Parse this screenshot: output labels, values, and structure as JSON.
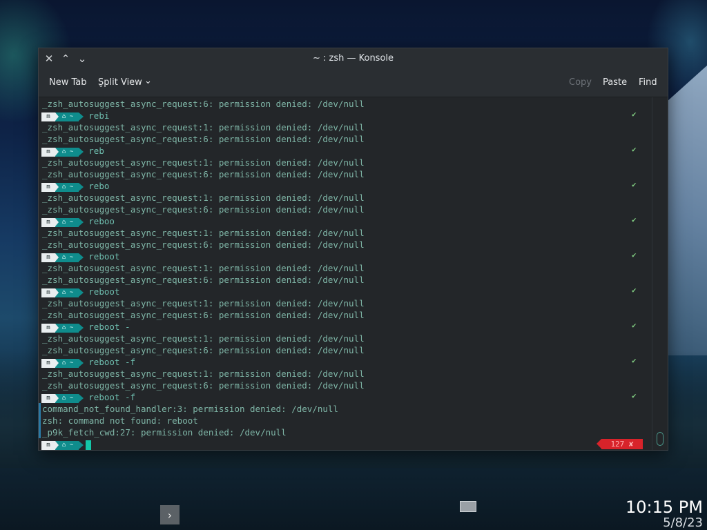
{
  "window": {
    "title": "~ : zsh — Konsole",
    "close_glyph": "✕",
    "minimize_glyph": "⌃",
    "maximize_glyph": "⌄"
  },
  "toolbar": {
    "new_tab": "New Tab",
    "split_view": "Split View",
    "split_chevron": "⌄",
    "copy": "Copy",
    "paste": "Paste",
    "find": "Find"
  },
  "prompt": {
    "os_glyph": "m",
    "home_glyph": "⌂ ~",
    "check": "✔"
  },
  "terminal_lines": [
    {
      "type": "text",
      "text": "_zsh_autosuggest_async_request:6: permission denied: /dev/null"
    },
    {
      "type": "prompt",
      "cmd": "rebi"
    },
    {
      "type": "text",
      "text": "_zsh_autosuggest_async_request:1: permission denied: /dev/null"
    },
    {
      "type": "text",
      "text": "_zsh_autosuggest_async_request:6: permission denied: /dev/null"
    },
    {
      "type": "prompt",
      "cmd": "reb"
    },
    {
      "type": "text",
      "text": "_zsh_autosuggest_async_request:1: permission denied: /dev/null"
    },
    {
      "type": "text",
      "text": "_zsh_autosuggest_async_request:6: permission denied: /dev/null"
    },
    {
      "type": "prompt",
      "cmd": "rebo"
    },
    {
      "type": "text",
      "text": "_zsh_autosuggest_async_request:1: permission denied: /dev/null"
    },
    {
      "type": "text",
      "text": "_zsh_autosuggest_async_request:6: permission denied: /dev/null"
    },
    {
      "type": "prompt",
      "cmd": "reboo"
    },
    {
      "type": "text",
      "text": "_zsh_autosuggest_async_request:1: permission denied: /dev/null"
    },
    {
      "type": "text",
      "text": "_zsh_autosuggest_async_request:6: permission denied: /dev/null"
    },
    {
      "type": "prompt",
      "cmd": "reboot"
    },
    {
      "type": "text",
      "text": "_zsh_autosuggest_async_request:1: permission denied: /dev/null"
    },
    {
      "type": "text",
      "text": "_zsh_autosuggest_async_request:6: permission denied: /dev/null"
    },
    {
      "type": "prompt",
      "cmd": "reboot"
    },
    {
      "type": "text",
      "text": "_zsh_autosuggest_async_request:1: permission denied: /dev/null"
    },
    {
      "type": "text",
      "text": "_zsh_autosuggest_async_request:6: permission denied: /dev/null"
    },
    {
      "type": "prompt",
      "cmd": "reboot -"
    },
    {
      "type": "text",
      "text": "_zsh_autosuggest_async_request:1: permission denied: /dev/null"
    },
    {
      "type": "text",
      "text": "_zsh_autosuggest_async_request:6: permission denied: /dev/null"
    },
    {
      "type": "prompt",
      "cmd": "reboot -f"
    },
    {
      "type": "text",
      "text": "_zsh_autosuggest_async_request:1: permission denied: /dev/null"
    },
    {
      "type": "text",
      "text": "_zsh_autosuggest_async_request:6: permission denied: /dev/null"
    },
    {
      "type": "prompt",
      "cmd": "reboot -f"
    },
    {
      "type": "text",
      "text": "command_not_found_handler:3: permission denied: /dev/null"
    },
    {
      "type": "text",
      "text": "zsh: command not found: reboot"
    },
    {
      "type": "text",
      "text": "_p9k_fetch_cwd:27: permission denied: /dev/null"
    }
  ],
  "status": {
    "exit_code": "127 ✘"
  },
  "taskbar": {
    "expand_glyph": "›",
    "time": "10:15 PM",
    "date": "5/8/23"
  }
}
